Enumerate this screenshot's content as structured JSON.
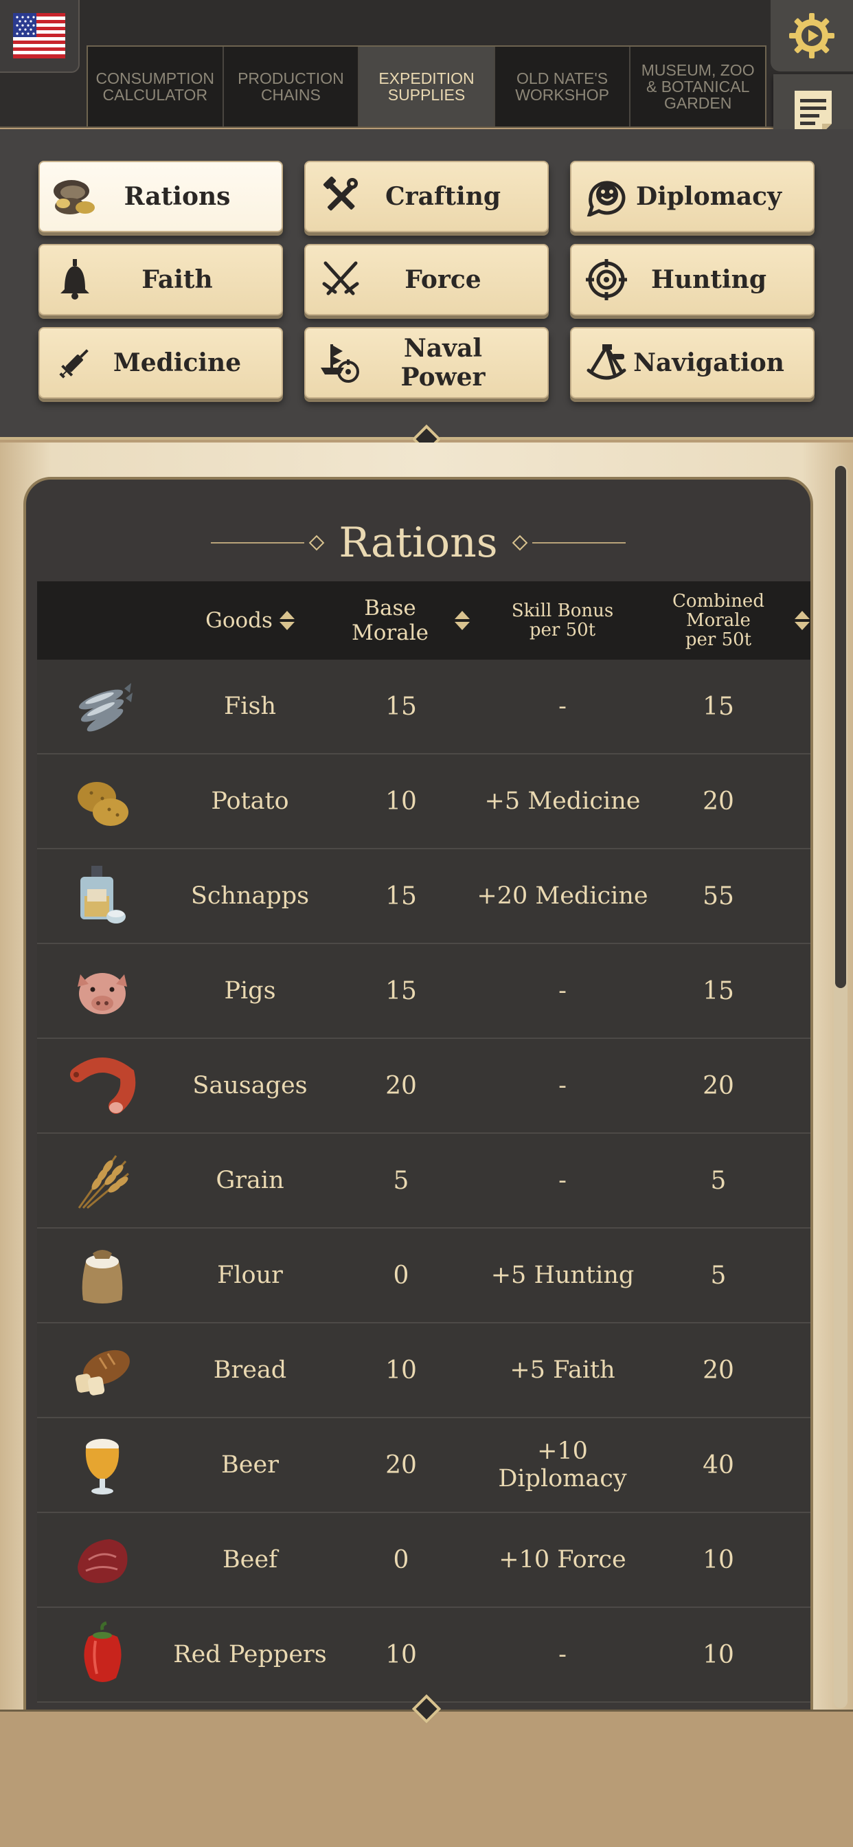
{
  "tabs": [
    {
      "label": "Consumption\nCalculator",
      "active": false
    },
    {
      "label": "Production\nChains",
      "active": false
    },
    {
      "label": "Expedition\nSupplies",
      "active": true
    },
    {
      "label": "Old Nate's\nWorkshop",
      "active": false
    },
    {
      "label": "Museum, Zoo\n& Botanical\nGarden",
      "active": false
    }
  ],
  "categories": [
    {
      "label": "Rations",
      "icon": "oyster-icon",
      "active": true
    },
    {
      "label": "Crafting",
      "icon": "tools-icon",
      "active": false
    },
    {
      "label": "Diplomacy",
      "icon": "speech-face-icon",
      "active": false
    },
    {
      "label": "Faith",
      "icon": "bell-icon",
      "active": false
    },
    {
      "label": "Force",
      "icon": "crossed-swords-icon",
      "active": false
    },
    {
      "label": "Hunting",
      "icon": "crosshair-icon",
      "active": false
    },
    {
      "label": "Medicine",
      "icon": "syringe-icon",
      "active": false
    },
    {
      "label": "Naval Power",
      "icon": "ship-target-icon",
      "active": false
    },
    {
      "label": "Navigation",
      "icon": "sextant-icon",
      "active": false
    }
  ],
  "panel": {
    "title": "Rations"
  },
  "table": {
    "headers": {
      "goods": "Goods",
      "base": "Base Morale",
      "skill": "Skill Bonus\nper 50t",
      "combined": "Combined Morale\nper 50t"
    },
    "rows": [
      {
        "goods": "Fish",
        "base": "15",
        "skill": "-",
        "combined": "15",
        "icon": "fish-icon"
      },
      {
        "goods": "Potato",
        "base": "10",
        "skill": "+5 Medicine",
        "combined": "20",
        "icon": "potato-icon"
      },
      {
        "goods": "Schnapps",
        "base": "15",
        "skill": "+20 Medicine",
        "combined": "55",
        "icon": "schnapps-bottle-icon"
      },
      {
        "goods": "Pigs",
        "base": "15",
        "skill": "-",
        "combined": "15",
        "icon": "pig-icon"
      },
      {
        "goods": "Sausages",
        "base": "20",
        "skill": "-",
        "combined": "20",
        "icon": "sausage-icon"
      },
      {
        "goods": "Grain",
        "base": "5",
        "skill": "-",
        "combined": "5",
        "icon": "grain-icon"
      },
      {
        "goods": "Flour",
        "base": "0",
        "skill": "+5 Hunting",
        "combined": "5",
        "icon": "flour-sack-icon"
      },
      {
        "goods": "Bread",
        "base": "10",
        "skill": "+5 Faith",
        "combined": "20",
        "icon": "bread-icon"
      },
      {
        "goods": "Beer",
        "base": "20",
        "skill": "+10 Diplomacy",
        "combined": "40",
        "icon": "beer-glass-icon"
      },
      {
        "goods": "Beef",
        "base": "0",
        "skill": "+10 Force",
        "combined": "10",
        "icon": "beef-icon"
      },
      {
        "goods": "Red Peppers",
        "base": "10",
        "skill": "-",
        "combined": "10",
        "icon": "red-pepper-icon"
      }
    ]
  },
  "colors": {
    "accent_gold": "#d9c38f",
    "button_cream": "#f2e1bb",
    "panel_dark": "#3b3837",
    "text_cream": "#ead9b2"
  }
}
